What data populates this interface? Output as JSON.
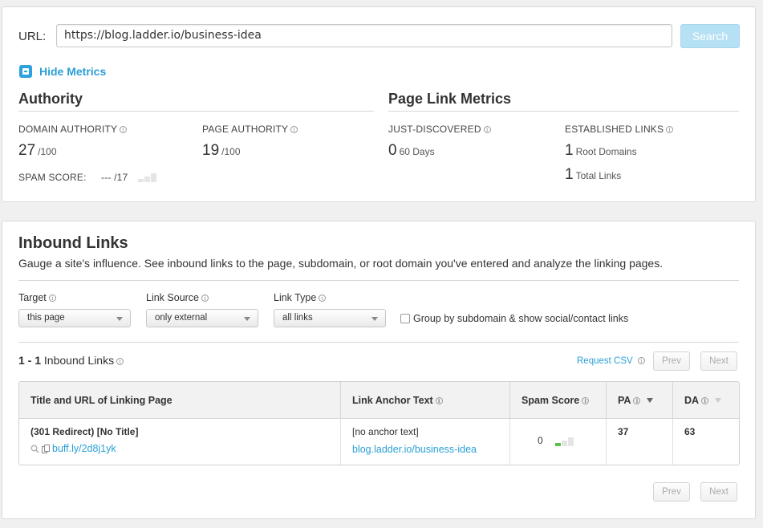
{
  "url_bar": {
    "label": "URL:",
    "value": "https://blog.ladder.io/business-idea",
    "search_label": "Search"
  },
  "toggle": {
    "hide_metrics_label": "Hide Metrics"
  },
  "authority": {
    "title": "Authority",
    "domain_authority_label": "DOMAIN AUTHORITY",
    "domain_authority_value": "27",
    "domain_authority_max": "/100",
    "page_authority_label": "PAGE AUTHORITY",
    "page_authority_value": "19",
    "page_authority_max": "/100",
    "spam_score_label": "SPAM SCORE:",
    "spam_score_value": "--- /17"
  },
  "page_link_metrics": {
    "title": "Page Link Metrics",
    "just_discovered_label": "JUST-DISCOVERED",
    "just_discovered_value": "0",
    "just_discovered_unit": "60 Days",
    "established_label": "ESTABLISHED LINKS",
    "root_domains_value": "1",
    "root_domains_unit": "Root Domains",
    "total_links_value": "1",
    "total_links_unit": "Total Links"
  },
  "inbound": {
    "title": "Inbound Links",
    "description": "Gauge a site's influence. See inbound links to the page, subdomain, or root domain you've entered and analyze the linking pages.",
    "filters": {
      "target_label": "Target",
      "target_value": "this page",
      "source_label": "Link Source",
      "source_value": "only external",
      "type_label": "Link Type",
      "type_value": "all links",
      "group_label": "Group by subdomain & show social/contact links"
    },
    "count_range": "1 - 1",
    "count_label": "Inbound Links",
    "request_csv": "Request CSV",
    "prev_label": "Prev",
    "next_label": "Next",
    "table": {
      "headers": {
        "title_url": "Title and URL of Linking Page",
        "anchor": "Link Anchor Text",
        "spam": "Spam Score",
        "pa": "PA",
        "da": "DA"
      },
      "rows": [
        {
          "title": "(301 Redirect) [No Title]",
          "url": "buff.ly/2d8j1yk",
          "anchor_text": "[no anchor text]",
          "anchor_url": "blog.ladder.io/business-idea",
          "spam_score": "0",
          "pa": "37",
          "da": "63"
        }
      ]
    }
  },
  "colors": {
    "accent": "#2a9fd6",
    "search_button": "#b6e0f3",
    "spam_low": "#5cc24a"
  },
  "icons": [
    "minus-box-icon",
    "info-icon",
    "magnifier-icon",
    "page-copy-icon",
    "sort-arrow-icon",
    "spam-bars-icon"
  ]
}
